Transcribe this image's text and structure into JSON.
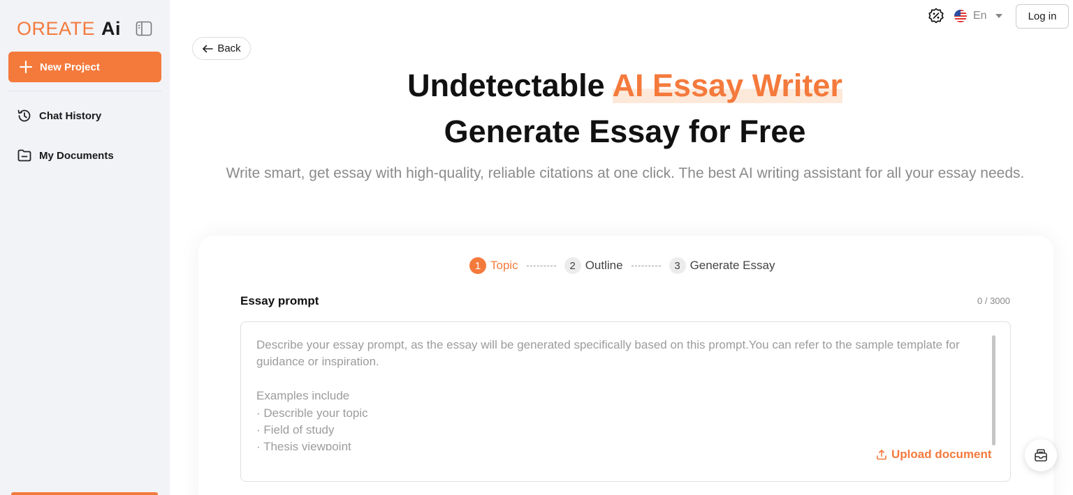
{
  "sidebar": {
    "logo_main": "OREATE",
    "logo_ai": "Ai",
    "new_project_label": "New Project",
    "items": [
      {
        "label": "Chat History",
        "icon": "history-icon"
      },
      {
        "label": "My Documents",
        "icon": "folder-icon"
      }
    ]
  },
  "header": {
    "language": "En",
    "login_label": "Log in"
  },
  "back_label": "Back",
  "hero": {
    "title_part1": "Undetectable ",
    "title_highlight": "AI Essay Writer",
    "title_line2": "Generate Essay for Free",
    "subtitle": "Write smart, get essay with high-quality, reliable citations at one click. The best AI writing assistant for all your essay needs."
  },
  "steps": [
    {
      "number": "1",
      "label": "Topic",
      "active": true
    },
    {
      "number": "2",
      "label": "Outline",
      "active": false
    },
    {
      "number": "3",
      "label": "Generate Essay",
      "active": false
    }
  ],
  "prompt": {
    "label": "Essay prompt",
    "counter": "0 / 3000",
    "placeholder": "Describe your essay prompt, as the essay will be generated specifically based on this prompt.You can refer to the sample template for guidance or inspiration.\n\nExamples include\n· Describle your topic\n· Field of study\n· Thesis viewpoint",
    "upload_label": "Upload document"
  },
  "colors": {
    "accent": "#f47a3c",
    "sidebar_bg": "#f1f3f7",
    "highlight_bg": "#fde9da"
  }
}
